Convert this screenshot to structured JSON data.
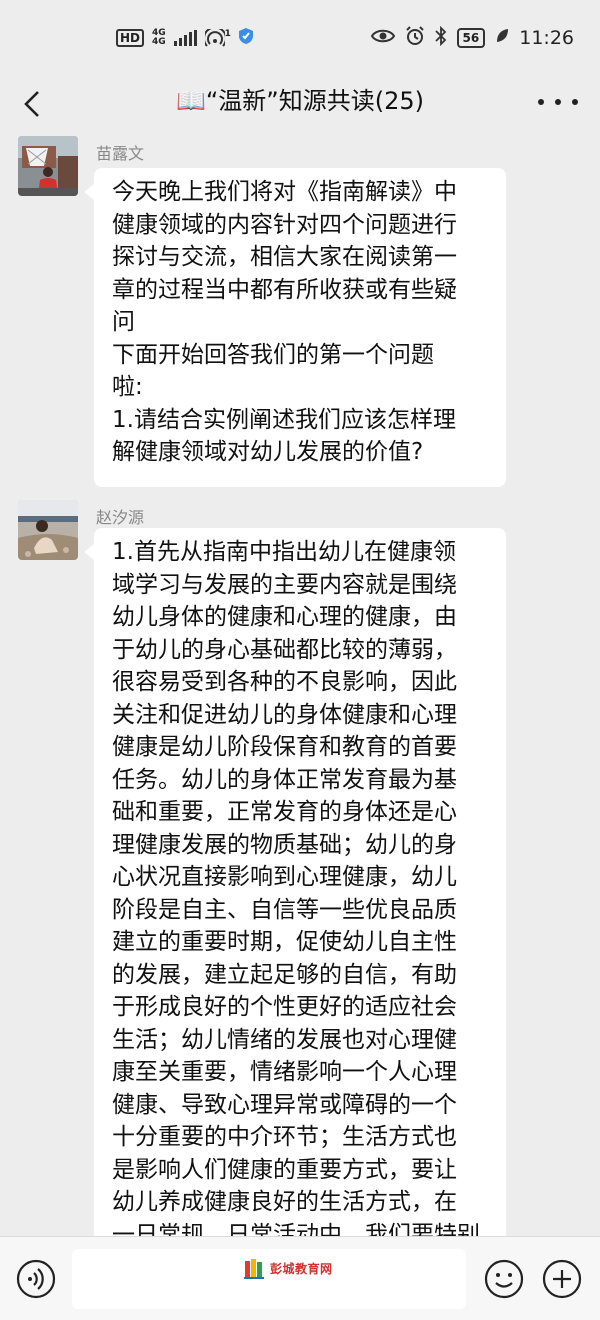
{
  "status_bar": {
    "hd": "HD",
    "network_top": "4G",
    "network_bottom": "4G",
    "hotspot_count": "1",
    "battery": "56",
    "time": "11:26"
  },
  "header": {
    "title": "📖“温新”知源共读(25)"
  },
  "messages": [
    {
      "sender": "苗露文",
      "text": "今天晚上我们将对《指南解读》中\n健康领域的内容针对四个问题进行\n探讨与交流，相信大家在阅读第一\n章的过程当中都有所收获或有些疑\n问\n下面开始回答我们的第一个问题\n啦:\n1.请结合实例阐述我们应该怎样理\n解健康领域对幼儿发展的价值?"
    },
    {
      "sender": "赵汐源",
      "text": "1.首先从指南中指出幼儿在健康领\n域学习与发展的主要内容就是围绕\n幼儿身体的健康和心理的健康，由\n于幼儿的身心基础都比较的薄弱，\n很容易受到各种的不良影响，因此\n关注和促进幼儿的身体健康和心理\n健康是幼儿阶段保育和教育的首要\n任务。幼儿的身体正常发育最为基\n础和重要，正常发育的身体还是心\n理健康发展的物质基础；幼儿的身\n心状况直接影响到心理健康，幼儿\n阶段是自主、自信等一些优良品质\n建立的重要时期，促使幼儿自主性\n的发展，建立起足够的自信，有助\n于形成良好的个性更好的适应社会\n生活；幼儿情绪的发展也对心理健\n康至关重要，情绪影响一个人心理\n健康、导致心理异常或障碍的一个\n十分重要的中介环节；生活方式也\n是影响人们健康的重要方式，要让\n幼儿养成健康良好的生活方式，在\n一日常规、日常活动中，我们要特别注重"
    }
  ],
  "input_bar": {
    "watermark": "彭城教育网"
  },
  "icons": {
    "back": "chevron-left-icon",
    "more": "more-dots-icon",
    "voice": "voice-icon",
    "emoji": "emoji-icon",
    "plus": "plus-icon"
  },
  "colors": {
    "background": "#ededed",
    "bubble": "#ffffff",
    "sender": "#888888",
    "watermark": "#d22f2f"
  }
}
